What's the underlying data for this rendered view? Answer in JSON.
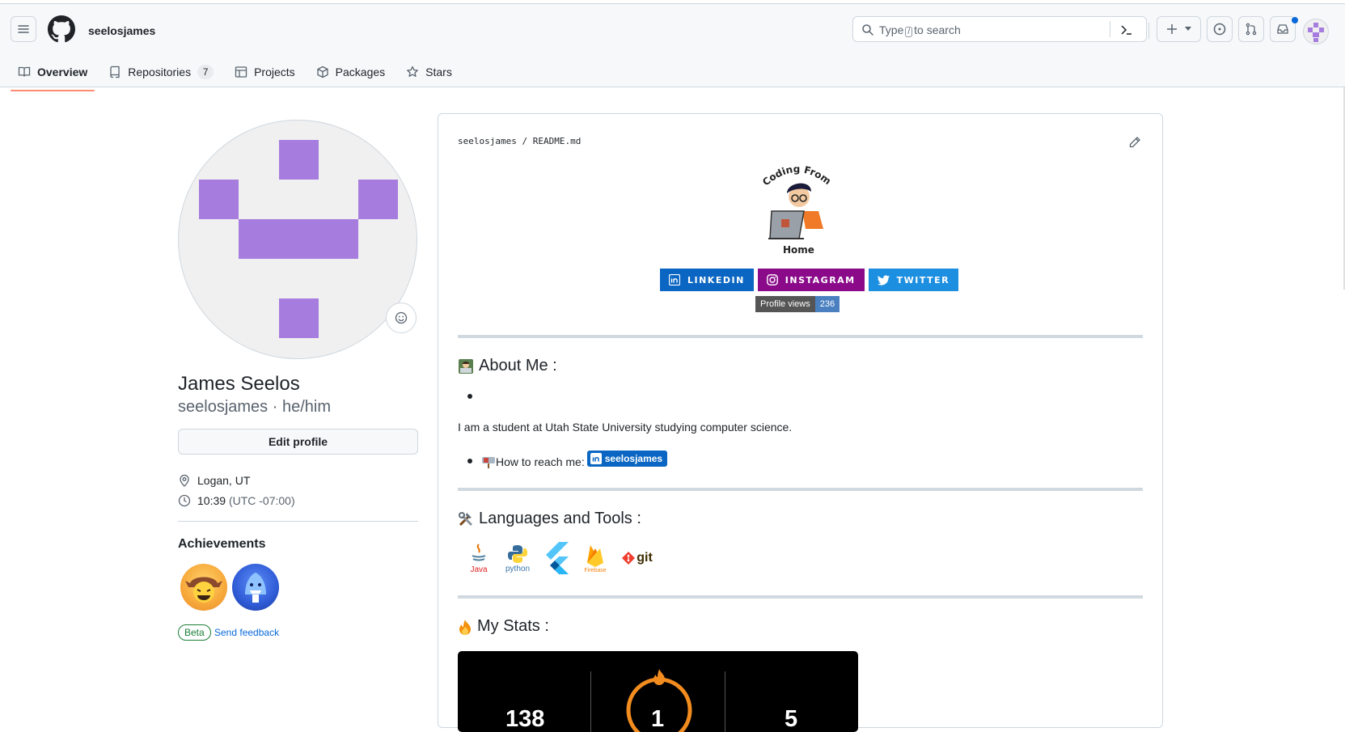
{
  "nav": {
    "username": "seelosjames",
    "search_prefix": "Type",
    "search_key": "/",
    "search_suffix": "to search"
  },
  "tabs": [
    {
      "label": "Overview",
      "active": true
    },
    {
      "label": "Repositories",
      "count": "7"
    },
    {
      "label": "Projects"
    },
    {
      "label": "Packages"
    },
    {
      "label": "Stars"
    }
  ],
  "profile": {
    "name": "James Seelos",
    "login": "seelosjames",
    "pronouns": "he/him",
    "separator": "·",
    "edit_label": "Edit profile",
    "location": "Logan, UT",
    "local_time": "10:39",
    "timezone": "(UTC -07:00)",
    "achievements_title": "Achievements",
    "beta_label": "Beta",
    "feedback_label": "Send feedback"
  },
  "readme": {
    "owner": "seelosjames",
    "path_sep": "/",
    "file": "README.md",
    "hero_top_text": "Coding From",
    "hero_bottom_text": "Home",
    "social_badges": [
      {
        "label": "LINKEDIN",
        "color": "#0a66c2"
      },
      {
        "label": "INSTAGRAM",
        "color": "#8a0a8a"
      },
      {
        "label": "TWITTER",
        "color": "#1d8fe0"
      }
    ],
    "views_label": "Profile views",
    "views_count": "236",
    "about_title": "About Me :",
    "about_text": "I am a student at Utah State University studying computer science.",
    "reach_label": "How to reach me:",
    "reach_badge": "seelosjames",
    "langs_title": "Languages and Tools :",
    "langs": [
      "Java",
      "python",
      "Firebase",
      "git"
    ],
    "stats_title": "My Stats :",
    "stats": [
      "138",
      "1",
      "5"
    ]
  },
  "colors": {
    "accent_tab": "#fd8c73",
    "avatar_purple": "#a67ddf",
    "link": "#0969da"
  }
}
